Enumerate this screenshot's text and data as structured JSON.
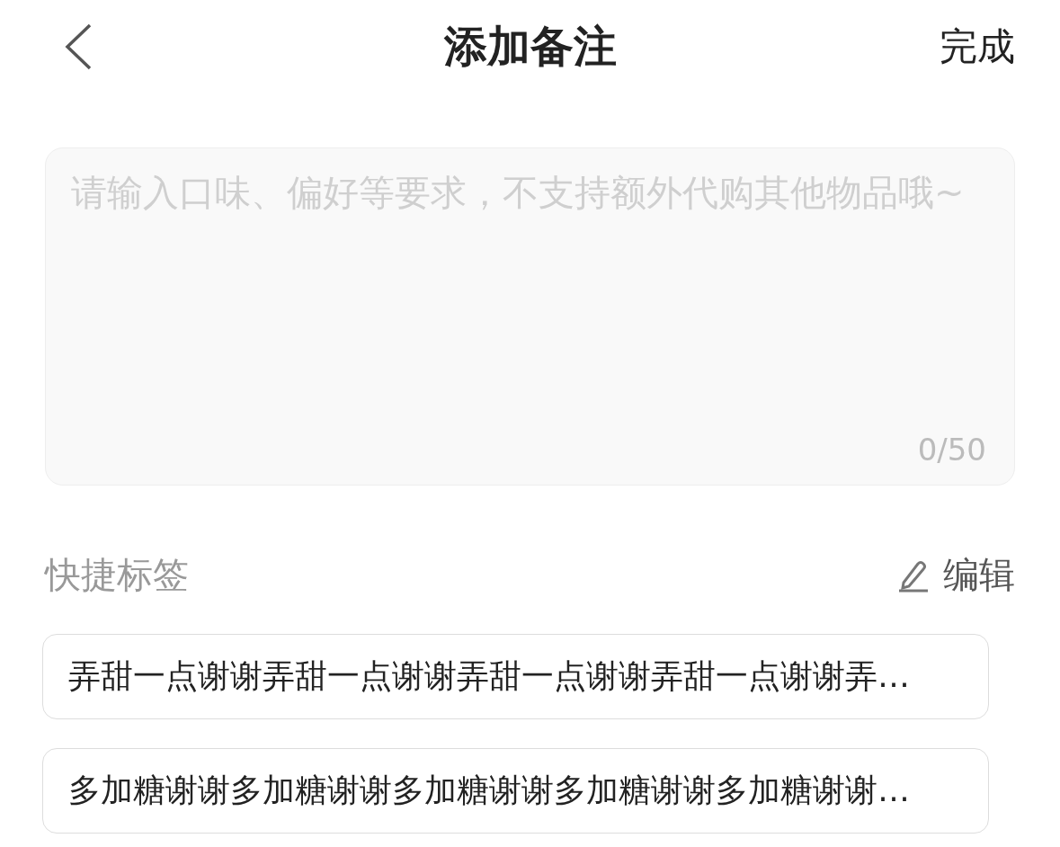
{
  "header": {
    "title": "添加备注",
    "done": "完成"
  },
  "note": {
    "placeholder": "请输入口味、偏好等要求，不支持额外代购其他物品哦~",
    "counter": "0/50"
  },
  "quick_tags": {
    "title": "快捷标签",
    "edit": "编辑",
    "tags": [
      "弄甜一点谢谢弄甜一点谢谢弄甜一点谢谢弄甜一点谢谢弄…",
      "多加糖谢谢多加糖谢谢多加糖谢谢多加糖谢谢多加糖谢谢…"
    ]
  }
}
